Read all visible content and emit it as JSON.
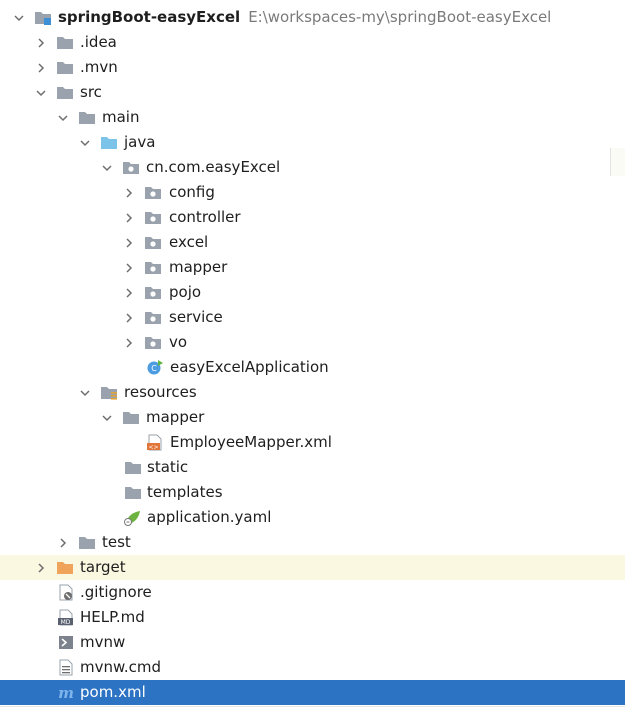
{
  "project": {
    "name": "springBoot-easyExcel",
    "path": "E:\\workspaces-my\\springBoot-easyExcel"
  },
  "tree": {
    "idea": ".idea",
    "mvn": ".mvn",
    "src": "src",
    "main": "main",
    "java": "java",
    "package": "cn.com.easyExcel",
    "config": "config",
    "controller": "controller",
    "excel": "excel",
    "mapper": "mapper",
    "pojo": "pojo",
    "service": "service",
    "vo": "vo",
    "app_class": "easyExcelApplication",
    "resources": "resources",
    "res_mapper": "mapper",
    "mapper_xml": "EmployeeMapper.xml",
    "static": "static",
    "templates": "templates",
    "app_yaml": "application.yaml",
    "test": "test",
    "target": "target",
    "gitignore": ".gitignore",
    "help": "HELP.md",
    "mvnw": "mvnw",
    "mvnw_cmd": "mvnw.cmd",
    "pom": "pom.xml"
  },
  "icons": {
    "module": "module-folder-icon",
    "folder": "folder-icon",
    "source_root": "source-root-folder-icon",
    "package": "package-icon",
    "resources": "resources-root-icon",
    "excluded": "excluded-folder-icon",
    "spring_class": "spring-boot-class-icon",
    "xml": "xml-file-icon",
    "yaml": "spring-config-icon",
    "ignore": "gitignore-file-icon",
    "markdown": "markdown-file-icon",
    "script": "shell-script-icon",
    "text": "text-file-icon",
    "maven": "maven-pom-icon"
  },
  "colors": {
    "selection": "#2c73c4",
    "target_row": "#fbf8e2",
    "excluded_folder": "#f0a35a",
    "source_folder": "#7cc3ea",
    "folder": "#9aa3ad"
  }
}
